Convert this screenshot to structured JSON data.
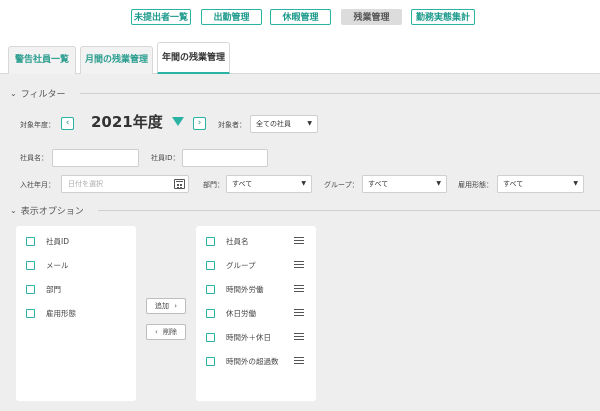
{
  "nav": {
    "items": [
      {
        "label": "未提出者一覧",
        "active": false
      },
      {
        "label": "出勤管理",
        "active": false
      },
      {
        "label": "休暇管理",
        "active": false
      },
      {
        "label": "残業管理",
        "active": true
      },
      {
        "label": "勤務実態集計",
        "active": false
      }
    ]
  },
  "tabs": [
    {
      "label": "警告社員一覧",
      "active": false
    },
    {
      "label": "月間の残業管理",
      "active": false
    },
    {
      "label": "年間の残業管理",
      "active": true
    }
  ],
  "filter": {
    "header": "フィルター",
    "year_label": "対象年度：",
    "year_value": "2021年度",
    "target_label": "対象者：",
    "target_value": "全ての社員",
    "name_label": "社員名：",
    "id_label": "社員ID：",
    "join_label": "入社年月：",
    "join_placeholder": "日付を選択",
    "dept_label": "部門：",
    "dept_value": "すべて",
    "group_label": "グループ：",
    "group_value": "すべて",
    "type_label": "雇用形態：",
    "type_value": "すべて"
  },
  "display": {
    "header": "表示オプション",
    "available": [
      "社員ID",
      "メール",
      "部門",
      "雇用形態"
    ],
    "selected": [
      "社員名",
      "グループ",
      "時間外労働",
      "休日労働",
      "時間外＋休日",
      "時間外の超過数"
    ],
    "add_label": "追加",
    "remove_label": "削除"
  },
  "colors": {
    "accent": "#2ab3a3",
    "background": "#eeeeee"
  }
}
